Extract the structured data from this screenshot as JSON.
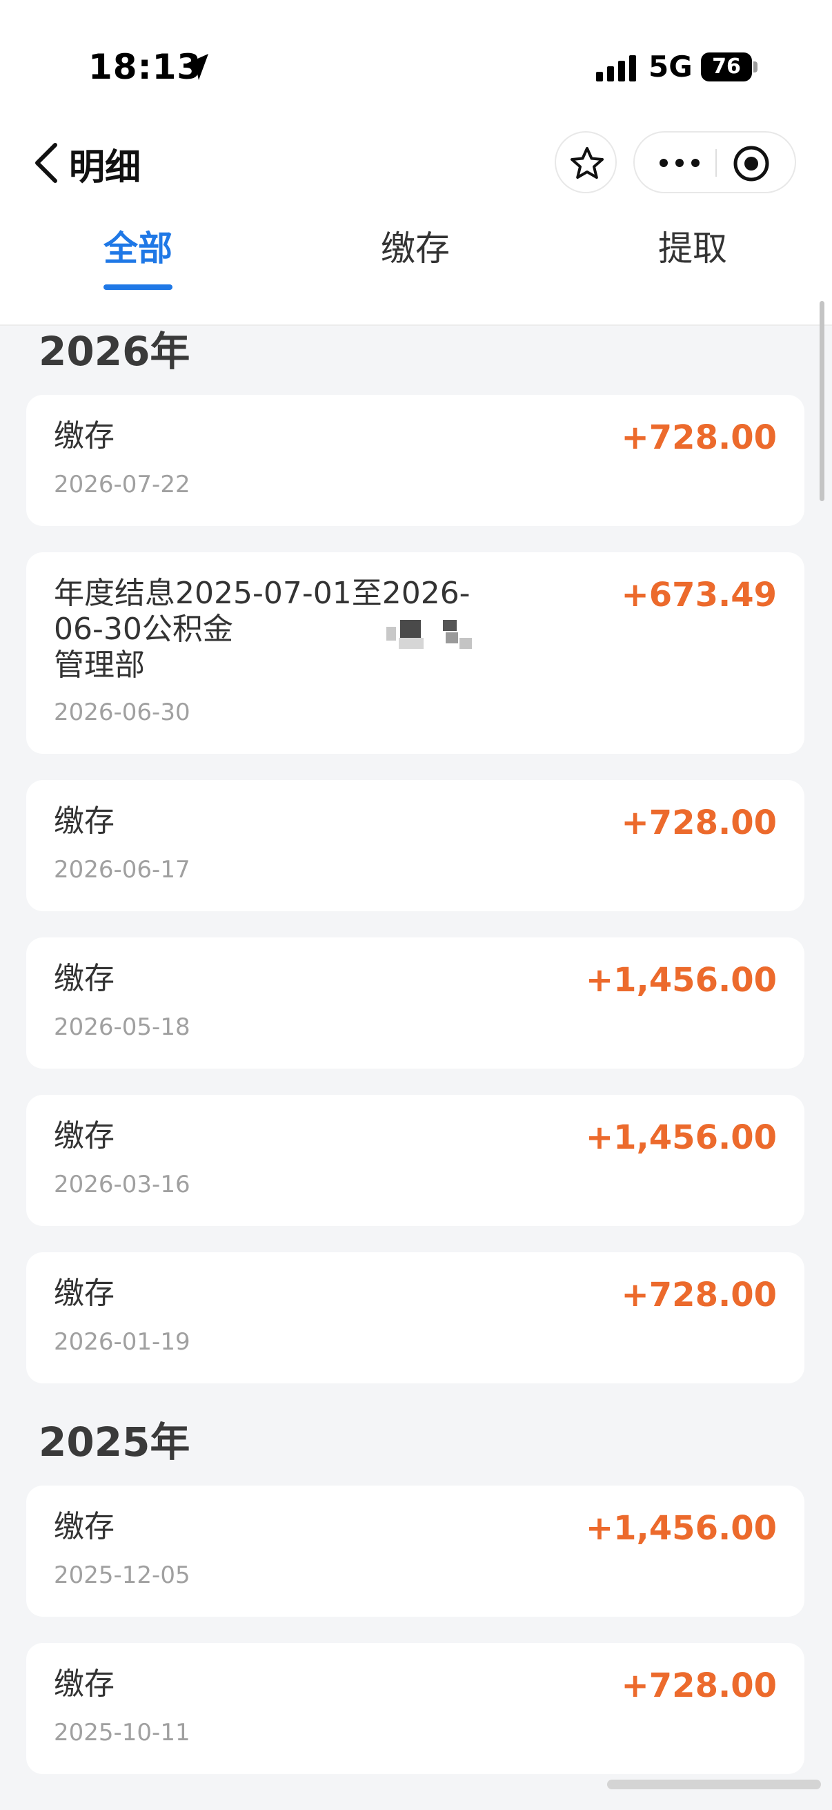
{
  "status_bar": {
    "time": "18:13",
    "network": "5G",
    "battery": "76",
    "icons": [
      "location-arrow-icon",
      "signal-bars-icon",
      "battery-icon"
    ]
  },
  "header": {
    "title": "明细",
    "icons": [
      "chevron-left-icon",
      "star-icon",
      "more-dots-icon",
      "target-circle-icon"
    ]
  },
  "tabs": [
    {
      "label": "全部",
      "active": true
    },
    {
      "label": "缴存",
      "active": false
    },
    {
      "label": "提取",
      "active": false
    }
  ],
  "colors": {
    "accent": "#1f78e6",
    "amount": "#ec6a2c",
    "background": "#f4f5f7",
    "card": "#ffffff",
    "secondary_text": "#a0a0a0"
  },
  "groups": [
    {
      "year": "2026年",
      "records": [
        {
          "title": "缴存",
          "date": "2026-07-22",
          "amount": "+728.00"
        },
        {
          "title": "年度结息2025-07-01至2026-06-30公积金",
          "title_suffix": "管理部",
          "date": "2026-06-30",
          "amount": "+673.49"
        },
        {
          "title": "缴存",
          "date": "2026-06-17",
          "amount": "+728.00"
        },
        {
          "title": "缴存",
          "date": "2026-05-18",
          "amount": "+1,456.00"
        },
        {
          "title": "缴存",
          "date": "2026-03-16",
          "amount": "+1,456.00"
        },
        {
          "title": "缴存",
          "date": "2026-01-19",
          "amount": "+728.00"
        }
      ]
    },
    {
      "year": "2025年",
      "records": [
        {
          "title": "缴存",
          "date": "2025-12-05",
          "amount": "+1,456.00"
        },
        {
          "title": "缴存",
          "date": "2025-10-11",
          "amount": "+728.00"
        }
      ]
    }
  ]
}
